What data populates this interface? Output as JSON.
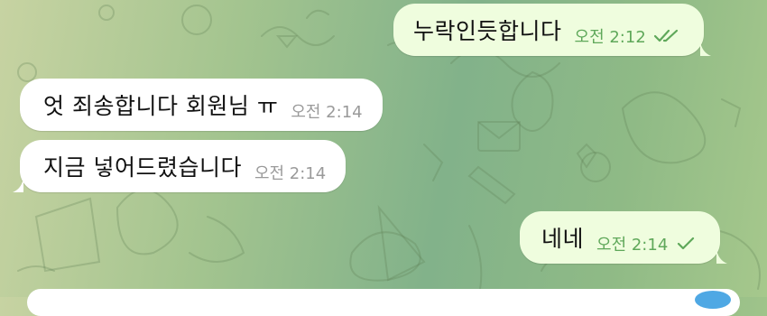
{
  "messages": [
    {
      "text": "누락인듯합니다",
      "time": "오전 2:12",
      "direction": "outgoing",
      "status": "read"
    },
    {
      "text": "엇 죄송합니다 회원님 ㅠ",
      "time": "오전 2:14",
      "direction": "incoming"
    },
    {
      "text": "지금 넣어드렸습니다",
      "time": "오전 2:14",
      "direction": "incoming"
    },
    {
      "text": "네네",
      "time": "오전 2:14",
      "direction": "outgoing",
      "status": "sent"
    }
  ],
  "colors": {
    "incoming_bubble": "#ffffff",
    "outgoing_bubble": "#effdde",
    "outgoing_meta": "#5fa85a",
    "incoming_meta": "#9a9a9a"
  },
  "icons": {
    "read": "double-check-icon",
    "sent": "single-check-icon"
  }
}
